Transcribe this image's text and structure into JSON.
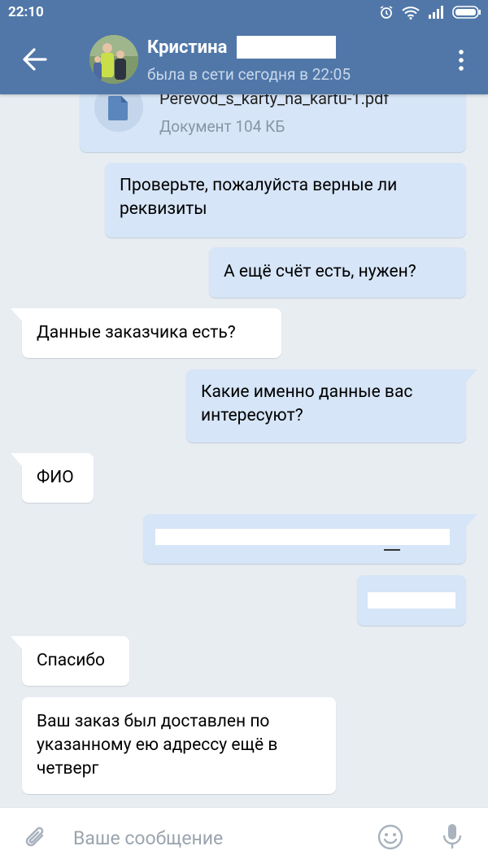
{
  "status_bar": {
    "time": "22:10"
  },
  "header": {
    "contact_name": "Кристина",
    "status": "была в сети сегодня в 22:05"
  },
  "messages": [
    {
      "id": "doc",
      "direction": "outgoing",
      "type": "document",
      "filename": "Perevod_s_karty_na_kartu-1.pdf",
      "meta": "Документ 104 КБ"
    },
    {
      "id": "m1",
      "direction": "outgoing",
      "text": "Проверьте,  пожалуйста верные ли реквизиты"
    },
    {
      "id": "m2",
      "direction": "outgoing",
      "text": "А ещё счёт есть,  нужен?"
    },
    {
      "id": "m3",
      "direction": "incoming",
      "text": "Данные заказчика есть?"
    },
    {
      "id": "m4",
      "direction": "outgoing",
      "text": "Какие именно данные вас интересуют?"
    },
    {
      "id": "m5",
      "direction": "incoming",
      "text": "ФИО"
    },
    {
      "id": "m6",
      "direction": "outgoing",
      "redacted": true
    },
    {
      "id": "m7",
      "direction": "outgoing",
      "redacted": true
    },
    {
      "id": "m8",
      "direction": "incoming",
      "text": "Спасибо"
    },
    {
      "id": "m9",
      "direction": "incoming",
      "text": "Ваш заказ был доставлен по указанному ею адрессу ещё в четверг"
    }
  ],
  "composer": {
    "placeholder": "Ваше сообщение"
  },
  "colors": {
    "header": "#5077a8",
    "background": "#e8edf2",
    "outgoing_bubble": "#d6e5f7",
    "incoming_bubble": "#ffffff"
  },
  "icons": [
    "alarm-icon",
    "wifi-icon",
    "signal-icon",
    "battery-icon",
    "back-arrow-icon",
    "more-vert-icon",
    "document-icon",
    "attach-icon",
    "emoji-icon",
    "mic-icon"
  ]
}
